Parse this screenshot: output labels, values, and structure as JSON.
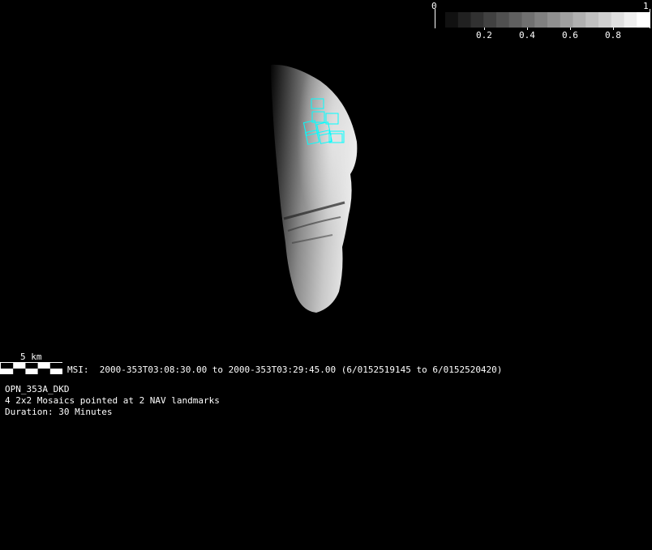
{
  "colorbar": {
    "min_label": "0",
    "max_label": "1",
    "tick_labels": [
      "0.2",
      "0.4",
      "0.6",
      "0.8"
    ],
    "segments": 16
  },
  "scale_bar": {
    "label": "5 km"
  },
  "msi_line": "MSI:  2000-353T03:08:30.00 to 2000-353T03:29:45.00 (6/0152519145 to 6/0152520420)",
  "info": {
    "sequence": "OPN_353A_DKD",
    "description": "4 2x2 Mosaics pointed at 2 NAV landmarks",
    "duration": "Duration: 30 Minutes"
  },
  "colors": {
    "footprint": "#00ffff",
    "background": "#000000"
  }
}
